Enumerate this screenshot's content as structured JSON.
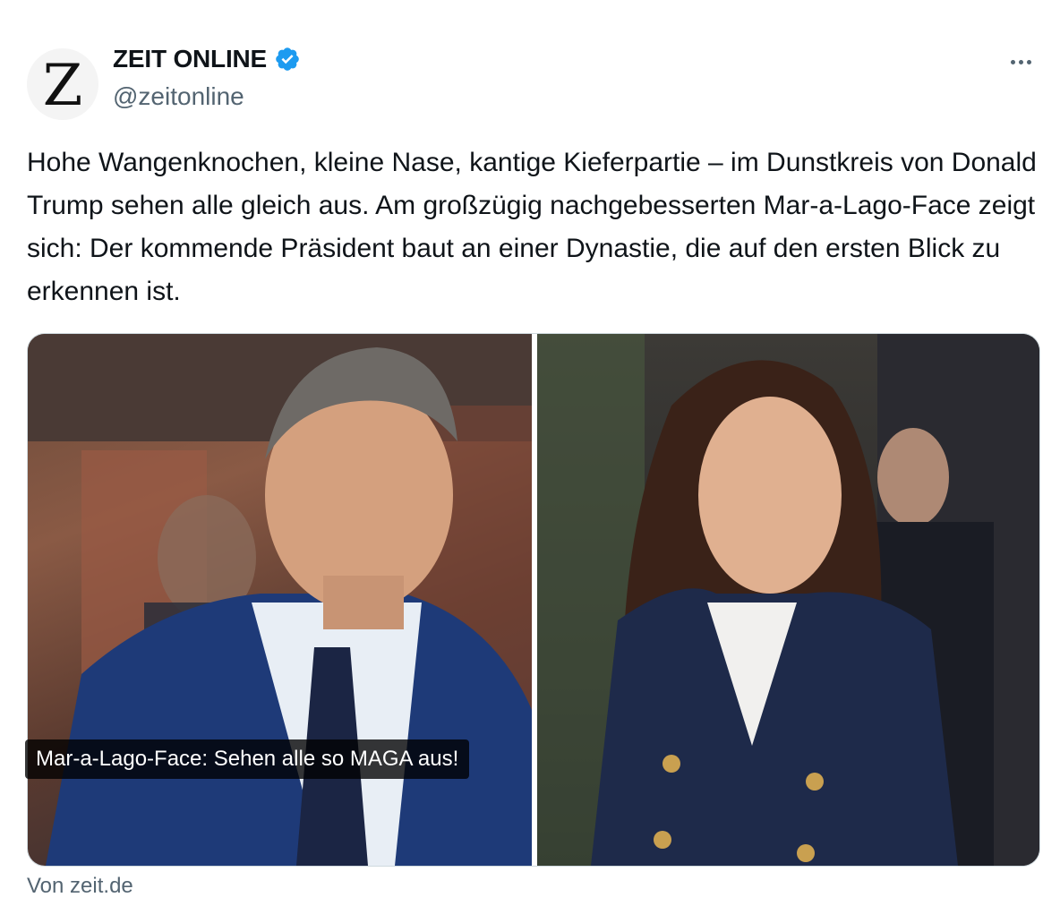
{
  "author": {
    "avatar_letter": "Z",
    "display_name": "ZEIT ONLINE",
    "handle": "@zeitonline",
    "verified": true
  },
  "tweet_text": "Hohe Wangenknochen, kleine Nase, kantige Kieferpartie – im Dunstkreis von Donald Trump sehen alle gleich aus. Am großzügig nachgebesserten Mar-a-Lago-Face zeigt sich: Der kommende Präsident baut an einer Dynastie, die auf den ersten Blick zu erkennen ist.",
  "link_card": {
    "caption": "Mar-a-Lago-Face: Sehen alle so MAGA aus!",
    "source": "Von zeit.de"
  },
  "colors": {
    "verified_blue": "#1d9bf0",
    "secondary_text": "#536471",
    "border": "#cfd9de"
  },
  "icons": {
    "verified": "verified-badge-icon",
    "more": "more-horizontal-icon"
  }
}
